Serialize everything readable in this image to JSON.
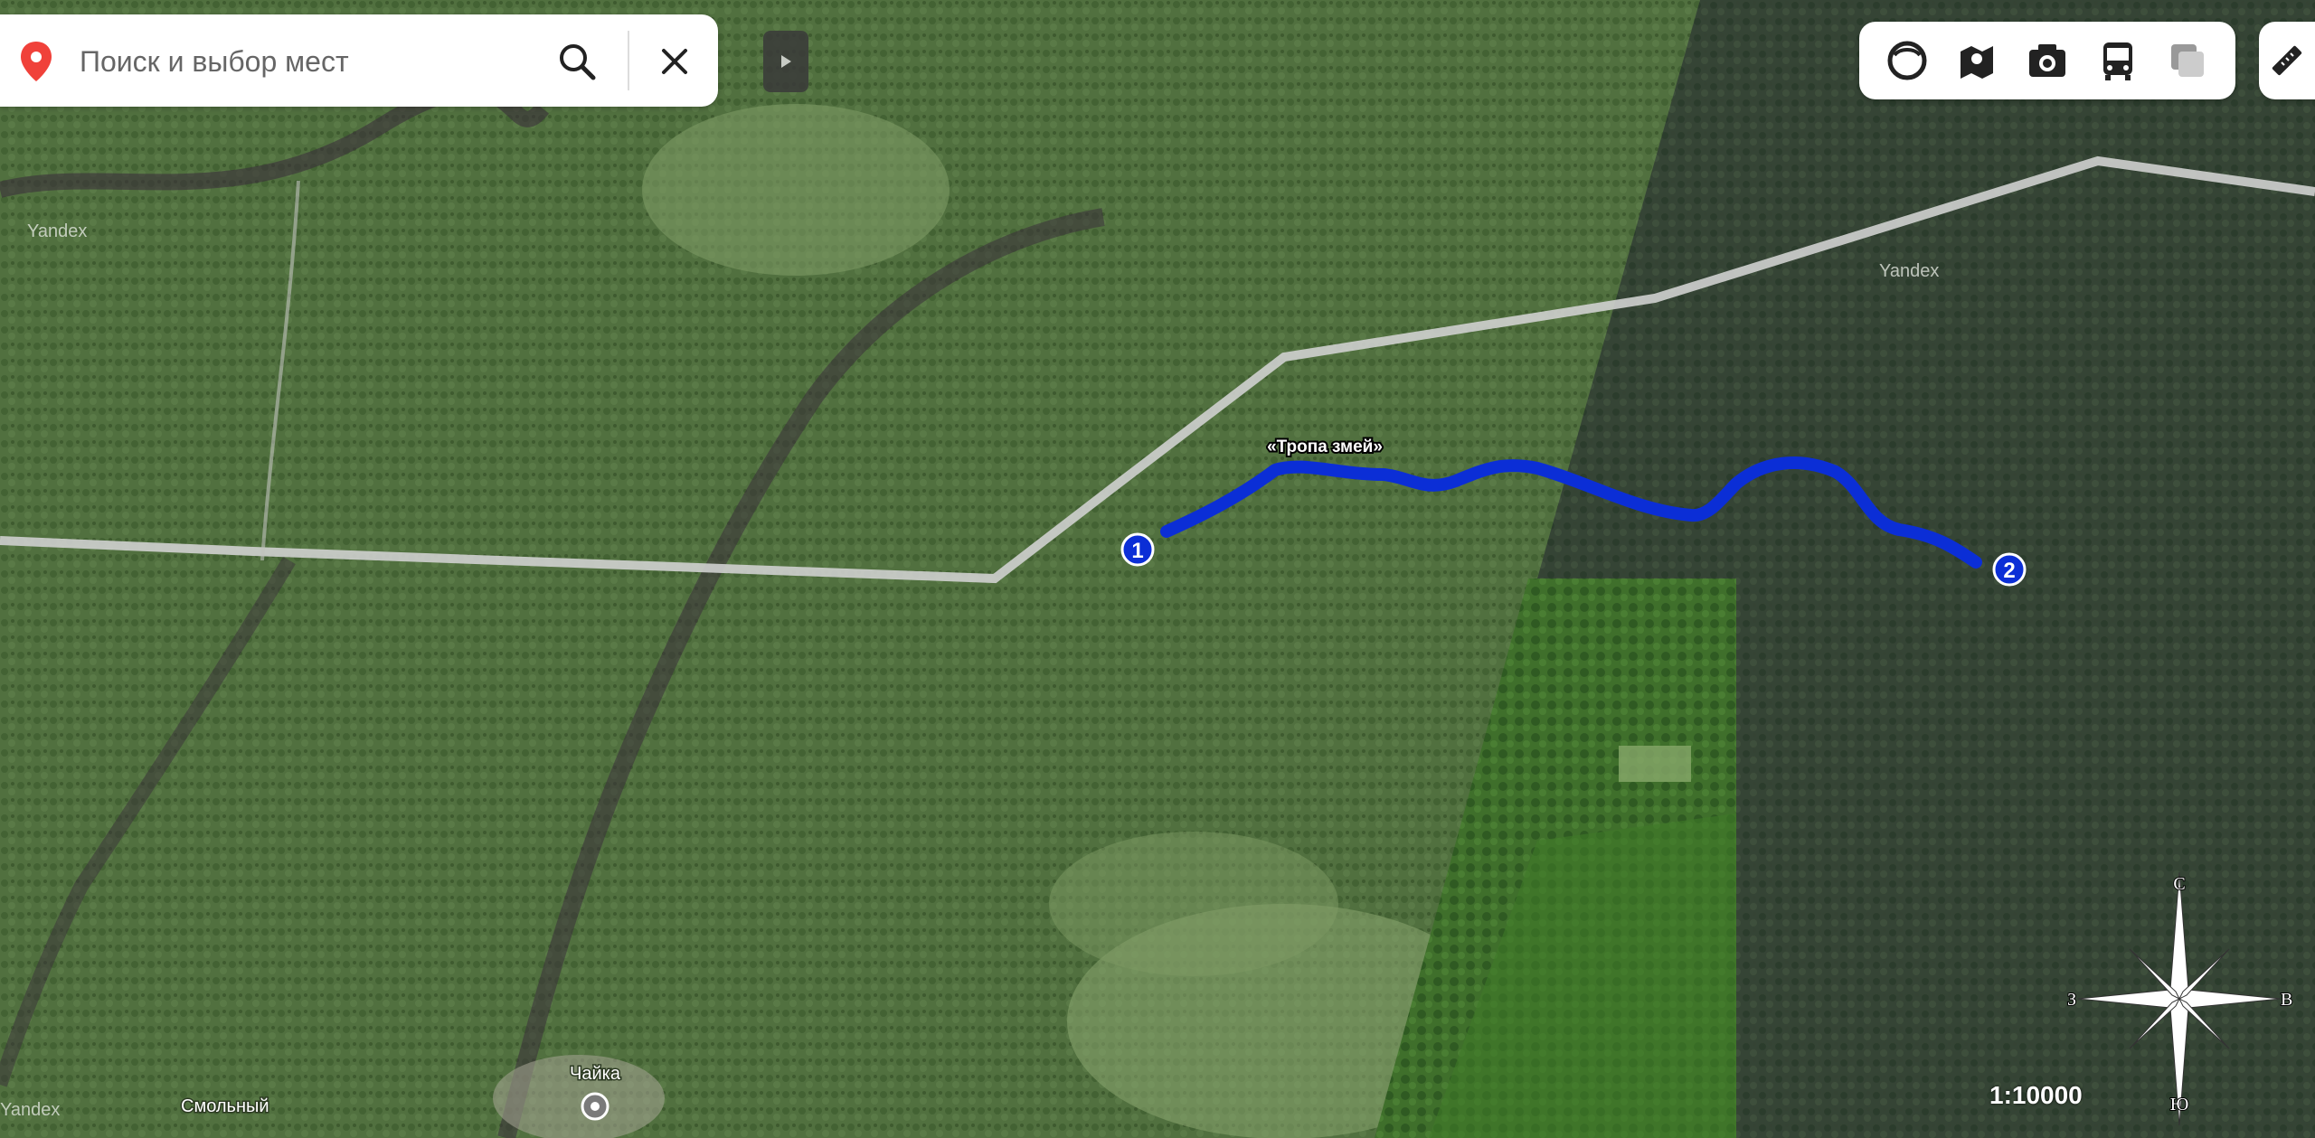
{
  "search": {
    "placeholder": "Поиск и выбор мест"
  },
  "map": {
    "watermarks": [
      "Yandex",
      "Yandex",
      "Yandex"
    ],
    "place_labels": {
      "smolny": "Смольный",
      "chayka": "Чайка"
    },
    "route": {
      "title": "«Тропа змей»",
      "start_marker": "1",
      "end_marker": "2",
      "color": "#0b2ed6"
    }
  },
  "layers": [
    "panorama-icon",
    "map-layers-icon",
    "photo-icon",
    "transit-icon",
    "traffic-icon"
  ],
  "scale_text": "1:10000",
  "compass": {
    "north": "С",
    "south": "Ю",
    "west": "З",
    "east": "В"
  },
  "colors": {
    "forest": "#4f6e3c",
    "road": "#cfd0cf",
    "route": "#0b2ed6",
    "accent_pin": "#f0413a"
  }
}
